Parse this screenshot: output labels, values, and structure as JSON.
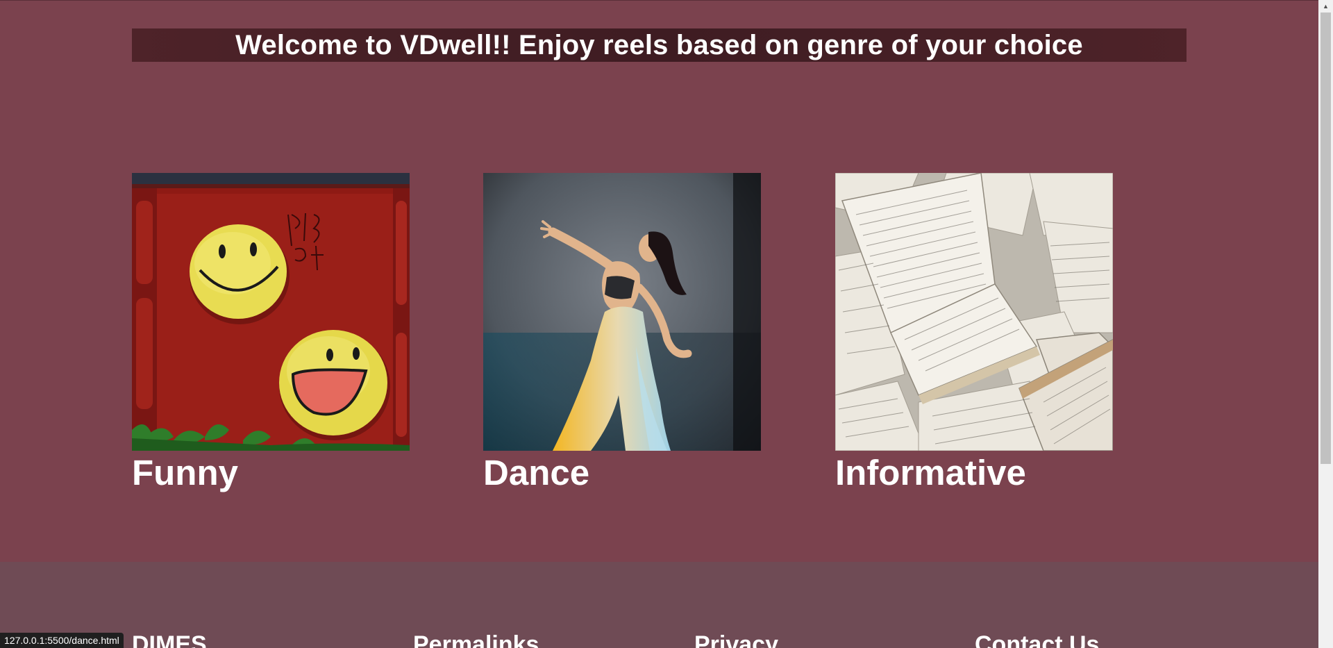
{
  "header": {
    "welcome_text": "Welcome to VDwell!! Enjoy reels based on genre of your choice"
  },
  "genres": [
    {
      "label": "Funny",
      "image": "smiley-faces-wall-image"
    },
    {
      "label": "Dance",
      "image": "dancer-image"
    },
    {
      "label": "Informative",
      "image": "open-books-image"
    }
  ],
  "footer": {
    "columns": [
      "DIMES",
      "Permalinks",
      "Privacy",
      "Contact Us"
    ]
  },
  "status_bar": {
    "url": "127.0.0.1:5500/dance.html"
  },
  "colors": {
    "page_background": "#7b424e",
    "banner_background": "#3e1c22",
    "footer_background": "#6f4b55",
    "text": "#ffffff"
  }
}
